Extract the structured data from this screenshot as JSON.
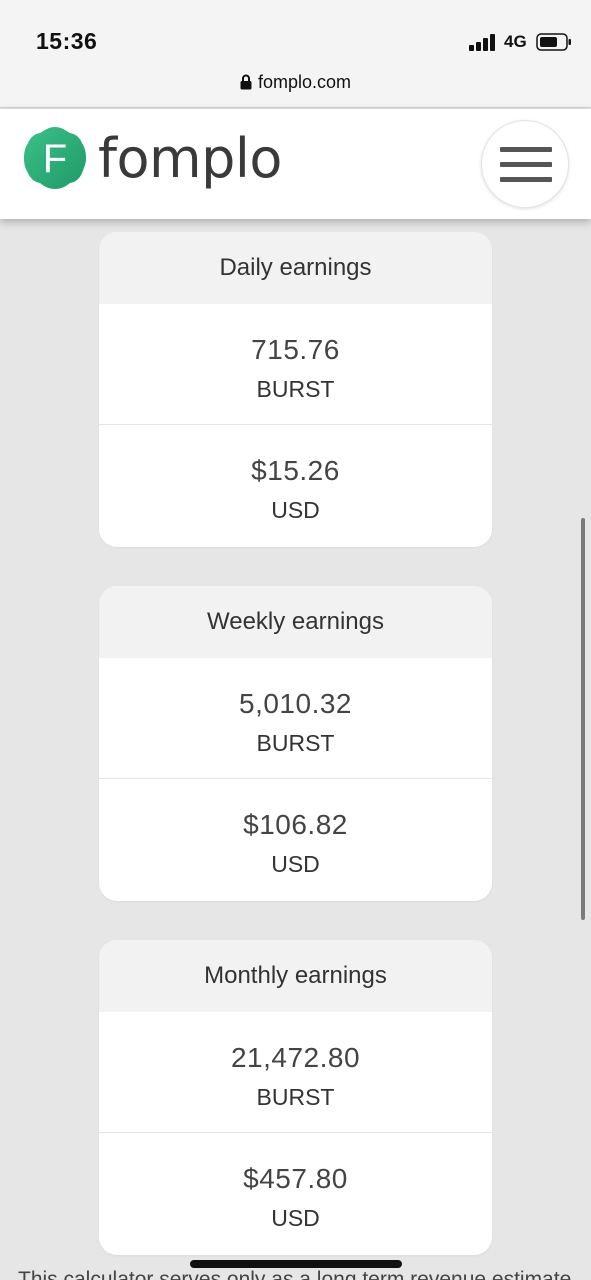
{
  "status_bar": {
    "time": "15:36",
    "network": "4G",
    "url": "fomplo.com"
  },
  "header": {
    "logo_letter": "F",
    "brand": "fomplo",
    "brand_color": "#2bb673"
  },
  "cards": [
    {
      "title": "Daily earnings",
      "burst_amount": "715.76",
      "burst_unit": "BURST",
      "usd_amount": "$15.26",
      "usd_unit": "USD"
    },
    {
      "title": "Weekly earnings",
      "burst_amount": "5,010.32",
      "burst_unit": "BURST",
      "usd_amount": "$106.82",
      "usd_unit": "USD"
    },
    {
      "title": "Monthly earnings",
      "burst_amount": "21,472.80",
      "burst_unit": "BURST",
      "usd_amount": "$457.80",
      "usd_unit": "USD"
    }
  ],
  "footer": {
    "disclaimer": "This calculator serves only as a long term revenue estimate"
  }
}
